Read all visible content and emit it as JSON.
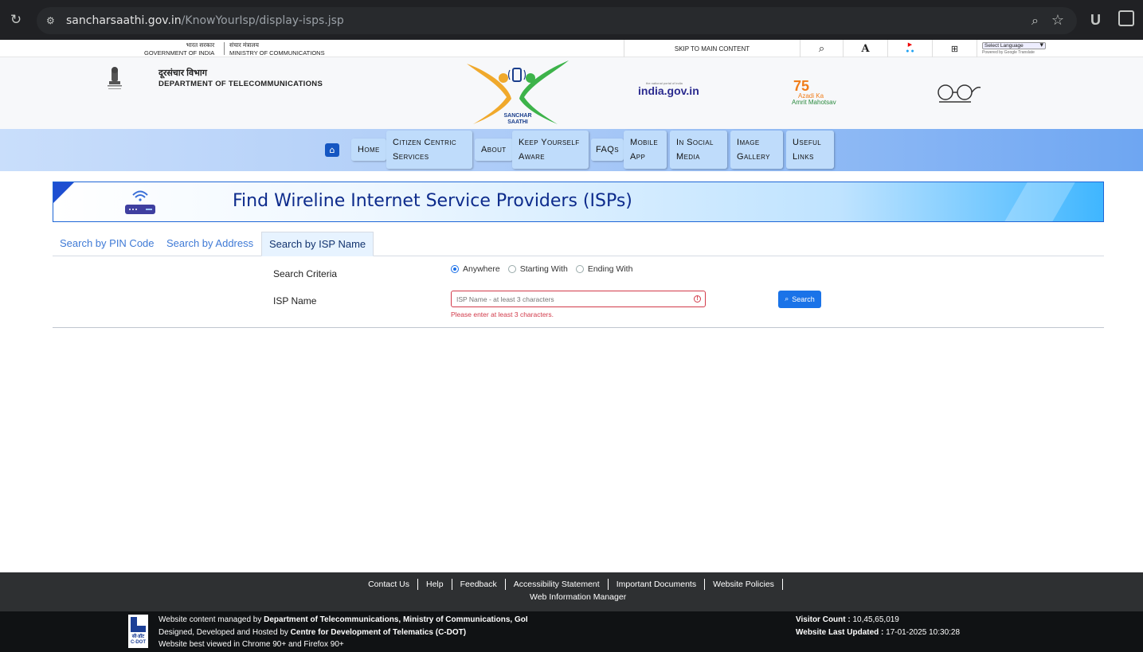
{
  "browser": {
    "url_host": "sancharsaathi.gov.in",
    "url_path": "/KnowYourIsp/display-isps.jsp",
    "ext_label": "U"
  },
  "gov_strip": {
    "gov_hi": "भारत सरकार",
    "gov_en": "GOVERNMENT OF INDIA",
    "min_hi": "संचार मंत्रालय",
    "min_en": "MINISTRY OF COMMUNICATIONS",
    "skip": "SKIP TO MAIN CONTENT",
    "font_label": "A",
    "language": "Select Language",
    "powered": "Powered by Google Translate"
  },
  "header": {
    "dept_hi": "दूरसंचार विभाग",
    "dept_en": "DEPARTMENT OF TELECOMMUNICATIONS",
    "logo_line1": "SANCHAR",
    "logo_line2": "SAATHI",
    "indiagov": "india.gov.in",
    "indiagov_tag": "the national portal of india",
    "azadi_75": "75",
    "azadi_1": "Azadi Ka",
    "azadi_2": "Amrit Mahotsav"
  },
  "nav": {
    "items": [
      {
        "label": "Home"
      },
      {
        "label1": "Citizen Centric",
        "label2": "Services"
      },
      {
        "label": "About"
      },
      {
        "label1": "Keep Yourself",
        "label2": "Aware"
      },
      {
        "label": "FAQs"
      },
      {
        "label1": "Mobile",
        "label2": "App"
      },
      {
        "label1": "In Social",
        "label2": "Media"
      },
      {
        "label1": "Image",
        "label2": "Gallery"
      },
      {
        "label1": "Useful",
        "label2": "Links"
      }
    ]
  },
  "banner": {
    "title": "Find Wireline Internet Service Providers (ISPs)"
  },
  "tabs": [
    {
      "label": "Search by PIN Code"
    },
    {
      "label": "Search by Address"
    },
    {
      "label": "Search by ISP Name"
    }
  ],
  "form": {
    "criteria_label": "Search Criteria",
    "options": [
      "Anywhere",
      "Starting With",
      "Ending With"
    ],
    "selected": "Anywhere",
    "isp_label": "ISP Name",
    "isp_placeholder": "ISP Name - at least 3 characters",
    "isp_value": "",
    "error": "Please enter at least 3 characters.",
    "search_label": "Search"
  },
  "footer": {
    "links": [
      "Contact Us",
      "Help",
      "Feedback",
      "Accessibility Statement",
      "Important Documents",
      "Website Policies"
    ],
    "link2": "Web Information Manager",
    "cdot_label": "सी-डॉट C-DOT",
    "line1_pre": "Website content managed by ",
    "line1_bold": "Department of Telecommunications, Ministry of Communications, GoI",
    "line2_pre": "Designed, Developed and Hosted by ",
    "line2_bold": "Centre for Development of Telematics (C-DOT)",
    "line3": "Website best viewed in Chrome 90+ and Firefox 90+",
    "visitor_label": "Visitor Count : ",
    "visitor_value": "10,45,65,019",
    "updated_label": "Website Last Updated : ",
    "updated_value": "17-01-2025 10:30:28"
  },
  "colors": {
    "primary": "#1a73e8",
    "error": "#d23a4a",
    "banner_title": "#0d2b8c",
    "footer_bg": "#2e3032"
  }
}
